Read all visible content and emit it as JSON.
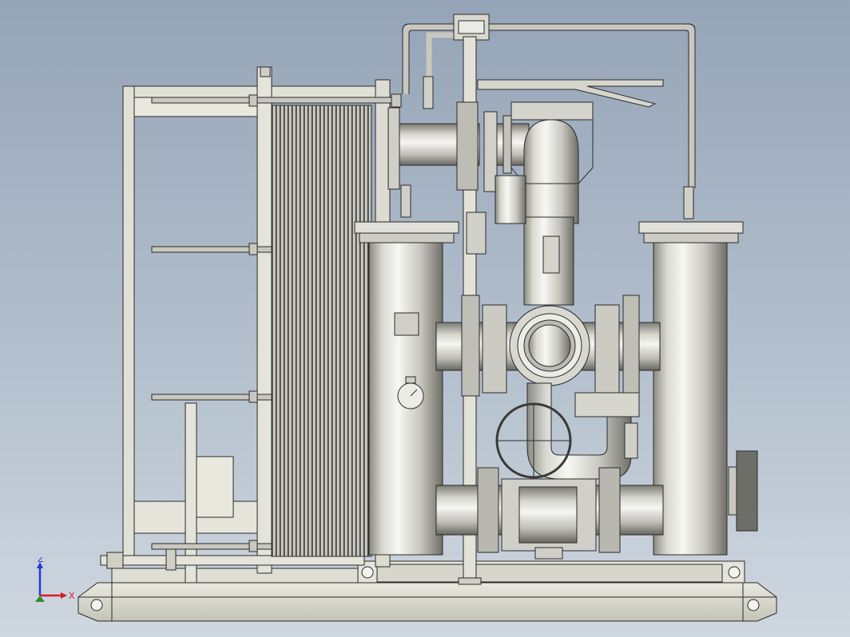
{
  "triad": {
    "z_label": "Z",
    "x_label": "X",
    "z_color": "#1f3bd6",
    "x_color": "#d42020",
    "y_color": "#2e8b2e"
  },
  "scene": {
    "background_top": "#95a4b7",
    "background_bottom": "#cfd7e0",
    "metal_light": "#f2f2ee",
    "metal_mid": "#c9c9c1",
    "metal_dark": "#7d7d74",
    "frame": "#dcdcd2",
    "outline": "#2a2a2a"
  }
}
